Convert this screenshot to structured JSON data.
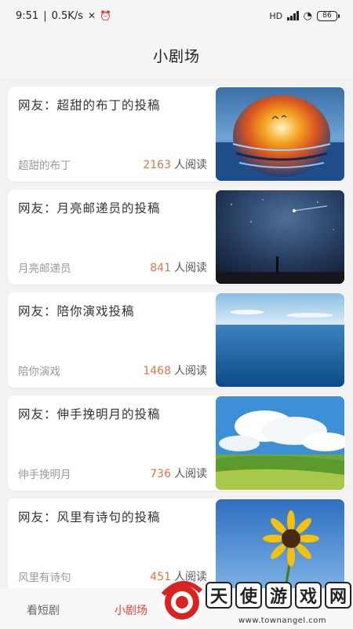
{
  "status_bar": {
    "time": "9:51",
    "speed": "0.5K/s",
    "network": "HD",
    "battery": "86"
  },
  "header": {
    "title": "小剧场"
  },
  "posts": [
    {
      "title": "网友：超甜的布丁的投稿",
      "author": "超甜的布丁",
      "reads": "2163",
      "reads_suffix": "人阅读",
      "image": "sunset-sphere-sea"
    },
    {
      "title": "网友：月亮邮递员的投稿",
      "author": "月亮邮递员",
      "reads": "841",
      "reads_suffix": "人阅读",
      "image": "night-sky-comet"
    },
    {
      "title": "网友：陪你演戏投稿",
      "author": "陪你演戏",
      "reads": "1468",
      "reads_suffix": "人阅读",
      "image": "calm-sea"
    },
    {
      "title": "网友：伸手挽明月的投稿",
      "author": "伸手挽明月",
      "reads": "736",
      "reads_suffix": "人阅读",
      "image": "grassland-clouds"
    },
    {
      "title": "网友：风里有诗句的投稿",
      "author": "风里有诗句",
      "reads": "451",
      "reads_suffix": "人阅读",
      "image": "sunflower-sky"
    }
  ],
  "tabbar": {
    "tabs": [
      {
        "label": "看短剧",
        "active": false
      },
      {
        "label": "小剧场",
        "active": true
      }
    ]
  },
  "watermark": {
    "chars": [
      "天",
      "使",
      "游",
      "戏",
      "网"
    ],
    "url": "www.townangel.com"
  },
  "colors": {
    "accent": "#e0734a",
    "active_tab": "#e0453a"
  }
}
